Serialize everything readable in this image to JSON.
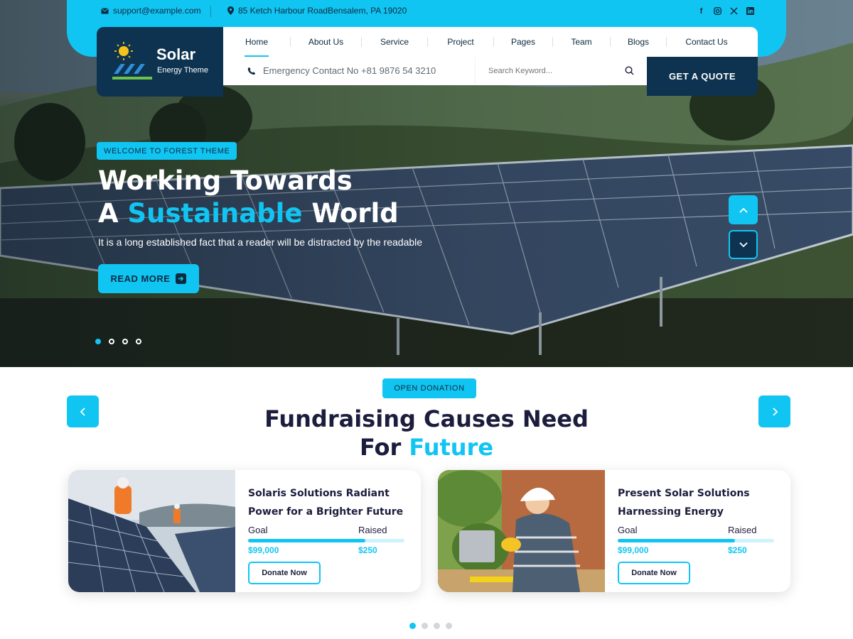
{
  "topbar": {
    "email": "support@example.com",
    "address": "85 Ketch Harbour RoadBensalem, PA 19020",
    "social_icons": [
      "facebook-icon",
      "instagram-icon",
      "x-icon",
      "linkedin-icon"
    ]
  },
  "brand": {
    "title": "Solar",
    "subtitle": "Energy Theme"
  },
  "nav": {
    "items": [
      {
        "label": "Home",
        "active": true
      },
      {
        "label": "About Us"
      },
      {
        "label": "Service"
      },
      {
        "label": "Project"
      },
      {
        "label": "Pages"
      },
      {
        "label": "Team"
      },
      {
        "label": "Blogs"
      },
      {
        "label": "Contact Us"
      }
    ]
  },
  "subbar": {
    "emergency": "Emergency Contact No +81 9876 54 3210",
    "search_placeholder": "Search Keyword...",
    "quote_label": "GET A QUOTE"
  },
  "hero": {
    "badge": "WELCOME TO FOREST THEME",
    "title_line1": "Working Towards",
    "title_line2_pre": "A ",
    "title_line2_accent": "Sustainable",
    "title_line2_post": " World",
    "description": "It is a long established fact that a reader will be distracted by the readable",
    "button_label": "READ MORE",
    "slide_count": 4,
    "active_slide": 1
  },
  "donation": {
    "badge": "OPEN DONATION",
    "title_line1": "Fundraising Causes Need",
    "title_line2_pre": "For ",
    "title_line2_accent": "Future",
    "cards": [
      {
        "title": "Solaris Solutions Radiant Power for a Brighter Future",
        "goal_label": "Goal",
        "raised_label": "Raised",
        "goal_value": "$99,000",
        "raised_value": "$250",
        "progress": 0.75,
        "button_label": "Donate Now"
      },
      {
        "title": "Present Solar Solutions Harnessing Energy",
        "goal_label": "Goal",
        "raised_label": "Raised",
        "goal_value": "$99,000",
        "raised_value": "$250",
        "progress": 0.75,
        "button_label": "Donate Now"
      }
    ],
    "carousel_dots": 4,
    "active_dot": 1
  },
  "colors": {
    "accent": "#11c5f2",
    "navy": "#0d3350",
    "heading": "#1c1d3d"
  }
}
